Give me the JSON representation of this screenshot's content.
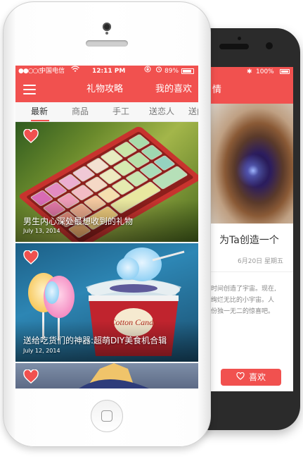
{
  "back_screen": {
    "status": {
      "bluetooth": "✱",
      "battery_text": "100%"
    },
    "header_partial": "情",
    "title_partial": "为Ta创造一个",
    "date": "6月20日  星期五",
    "body_lines": [
      "时间创造了宇宙。现在,",
      "绚烂无比的小宇宙。人",
      "份独一无二的惊喜吧。"
    ],
    "like_button_label": "喜欢",
    "like_icon": "heart-outline-icon"
  },
  "front_screen": {
    "status": {
      "signal": "●●○○○",
      "carrier": "中国电信",
      "wifi": "wifi-icon",
      "time": "12:11 PM",
      "lock_icon": "rotation-lock-icon",
      "alarm_icon": "alarm-icon",
      "battery_text": "89%"
    },
    "header": {
      "menu_icon": "hamburger-menu-icon",
      "nav_a": "礼物攻略",
      "nav_b": "我的喜欢"
    },
    "tabs": [
      {
        "label": "最新",
        "active": true
      },
      {
        "label": "商品",
        "active": false
      },
      {
        "label": "手工",
        "active": false
      },
      {
        "label": "送恋人",
        "active": false
      },
      {
        "label": "送闺",
        "active": false
      }
    ],
    "cards": [
      {
        "title": "男生内心深处最想收到的礼物",
        "date": "July 13, 2014",
        "image": "mechanical-keyboard-photo"
      },
      {
        "title": "送给吃货们的神器:超萌DIY美食机合辑",
        "date": "July 12, 2014",
        "image": "cotton-candy-machine-photo",
        "image_text": "Cotton Candy"
      },
      {
        "title": "",
        "date": "",
        "image": "toy-figure-photo"
      }
    ]
  },
  "colors": {
    "accent": "#f1514f",
    "tab_bg": "#f7f7f7",
    "back_phone": "#2b2b2b"
  }
}
